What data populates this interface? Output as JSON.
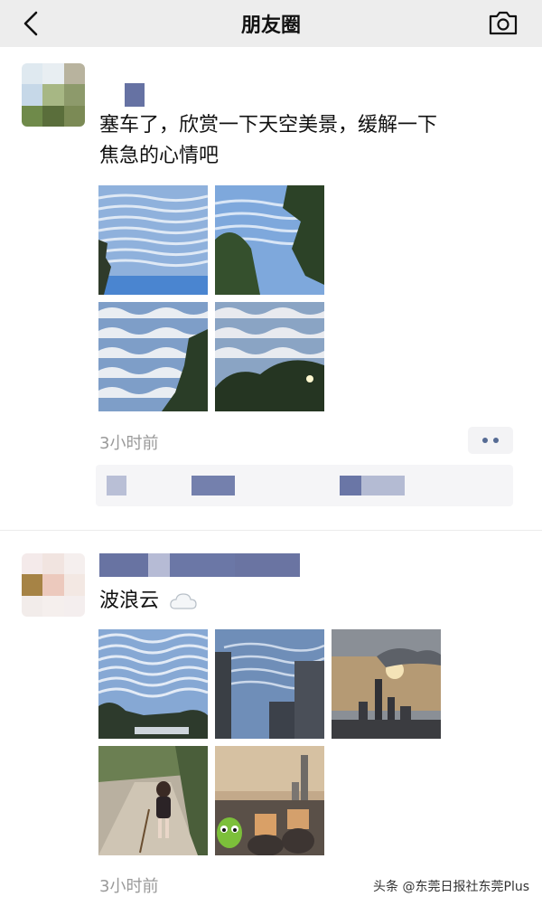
{
  "header": {
    "title": "朋友圈",
    "back_icon": "chevron-left-icon",
    "camera_icon": "camera-icon"
  },
  "posts": [
    {
      "text_line1": "塞车了，欣赏一下天空美景，缓解一下",
      "text_line2": "焦急的心情吧",
      "photo_count": 4,
      "time": "3小时前"
    },
    {
      "text": "波浪云",
      "emoji": "cloud-emoji",
      "photo_count": 5,
      "time": "3小时前"
    }
  ],
  "watermark": "头条 @东莞日报社东莞Plus"
}
